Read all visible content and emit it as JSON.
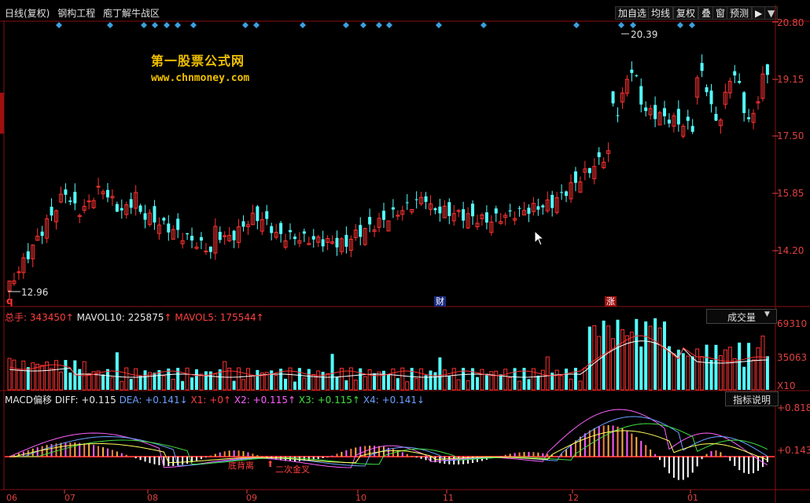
{
  "header": {
    "period": "日线(复权)",
    "stock_name": "钢构工程",
    "title": "庖丁解牛战区"
  },
  "toolbar": {
    "add_watchlist": "加自选",
    "ma_line": "均线",
    "restore_rights": "复权",
    "overlay": "叠",
    "window": "窗",
    "forecast": "预测",
    "nav": "▶"
  },
  "watermark": {
    "line1": "第一股票公式网",
    "line2": "www.chnmoney.com"
  },
  "price_axis": [
    "20.80",
    "19.15",
    "17.50",
    "15.85",
    "14.20"
  ],
  "annotations": {
    "high": "20.39",
    "low": "12.96",
    "q_marker": "q",
    "event_finance": "财",
    "event_up": "涨"
  },
  "volume_panel": {
    "total_label": "总手:",
    "total_value": "343450",
    "mavol10_label": "MAVOL10:",
    "mavol10_value": "225875",
    "mavol5_label": "MAVOL5:",
    "mavol5_value": "175544",
    "dropdown": "成交量",
    "axis": [
      "69310",
      "35063",
      "X10"
    ]
  },
  "macd_panel": {
    "title": "MACD偏移",
    "diff": "DIFF: +0.115",
    "dea": "DEA: +0.141",
    "x1": "X1: +0",
    "x2": "X2: +0.115",
    "x3": "X3: +0.115",
    "x4": "X4: +0.141",
    "help_button": "指标说明",
    "axis": [
      "+0.818",
      "+0.143"
    ],
    "label_bottom": "底背离",
    "label_cross": "二次金叉"
  },
  "x_axis": [
    "06",
    "07",
    "08",
    "09",
    "10",
    "11",
    "12",
    "01"
  ],
  "colors": {
    "up": "#ff3232",
    "down": "#54ffff",
    "ma_white": "#ffffff",
    "ma_yellow": "#ffff00",
    "ma_pink": "#ff80ff"
  }
}
